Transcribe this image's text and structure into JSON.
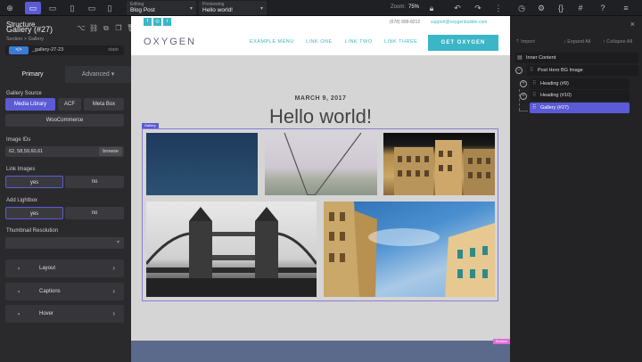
{
  "toolbar": {
    "editing_label": "Editing",
    "editing_value": "Blog Post",
    "previewing_label": "Previewing",
    "previewing_value": "Hello world!",
    "zoom_label": "Zoom:",
    "zoom_value": "75%"
  },
  "left_panel": {
    "title": "Gallery (#27)",
    "breadcrumb": "Section > Gallery",
    "selector_badge": "</>",
    "selector_name": "_gallery-27-23",
    "selector_state": "state",
    "tabs": {
      "primary": "Primary",
      "advanced": "Advanced"
    },
    "gallery_source_label": "Gallery Source",
    "sources": [
      "Media Library",
      "ACF",
      "Meta Box",
      "WooCommerce"
    ],
    "image_ids_label": "Image IDs",
    "image_ids_value": "62, 58,59,60,61",
    "browse_label": "browse",
    "link_images_label": "Link Images",
    "add_lightbox_label": "Add Lightbox",
    "yes": "yes",
    "no": "no",
    "thumb_res_label": "Thumbnail Resolution",
    "sections": [
      "Layout",
      "Captions",
      "Hover"
    ]
  },
  "site": {
    "phone": "(678) 999-8212",
    "email": "support@oxygenbuilder.com",
    "logo": "OXYGEN",
    "nav": [
      "EXAMPLE MENU",
      "LINK ONE",
      "LINK TWO",
      "LINK THREE"
    ],
    "cta": "GET OXYGEN",
    "date": "MARCH 9, 2017",
    "heading": "Hello world!",
    "gallery_tag": "Gallery",
    "footer_tag": "Section"
  },
  "structure": {
    "title": "Structure",
    "import": "Import",
    "expand_all": "Expand All",
    "collapse_all": "Collapse All",
    "items": [
      "Inner Content",
      "Post Hero BG Image",
      "Heading (#9)",
      "Heading (#10)",
      "Gallery (#27)"
    ]
  }
}
